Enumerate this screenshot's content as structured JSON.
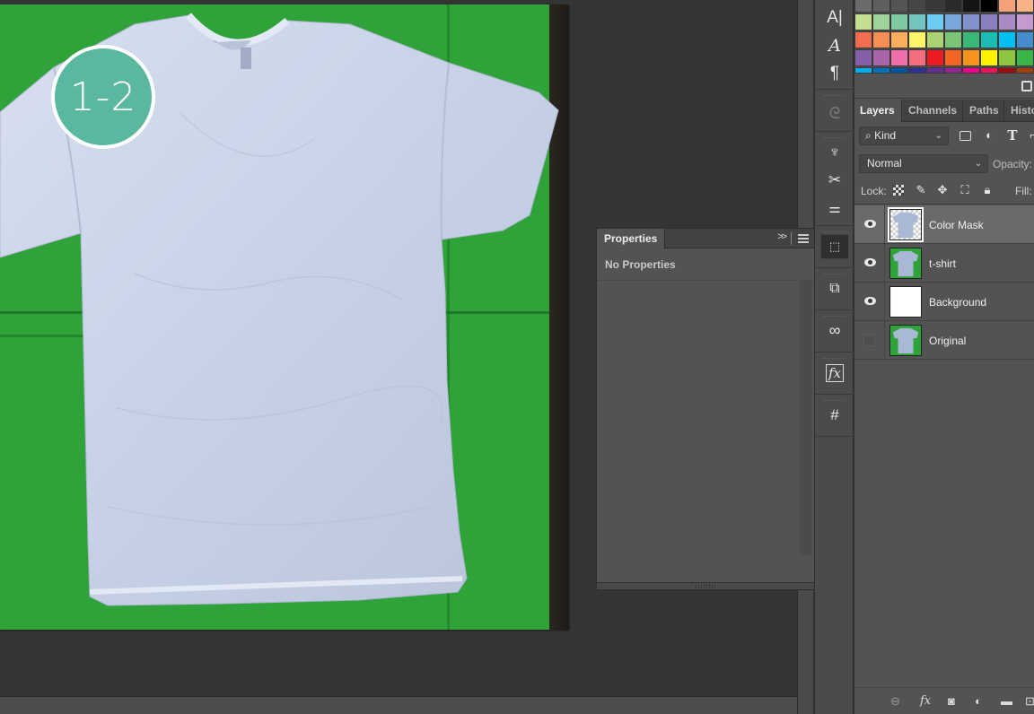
{
  "canvas": {
    "step_badge": "1-2",
    "colors": {
      "green_screen": "#2fa33a",
      "badge": "#5ab8a0"
    }
  },
  "properties_panel": {
    "tab_label": "Properties",
    "collapse_glyph": ">>",
    "empty_text": "No Properties"
  },
  "icon_strip": {
    "groups": [
      [
        "character-icon",
        "character-styles-icon",
        "paragraph-icon"
      ],
      [
        "3d-icon"
      ],
      [
        "brush-presets-icon",
        "tool-presets-icon",
        "brush-settings-icon"
      ],
      [
        "properties-icon"
      ],
      [
        "clone-source-icon"
      ],
      [
        "creative-cloud-libraries-icon"
      ],
      [
        "styles-icon"
      ],
      [
        "patterns-icon"
      ]
    ]
  },
  "swatches": {
    "rows": [
      [
        "#6b6b6b",
        "#5f5f5f",
        "#545454",
        "#464646",
        "#383838",
        "#2a2a2a",
        "#151515",
        "#000000",
        "#f4a07a",
        "#f7b286"
      ],
      [
        "#c4df8f",
        "#9ed39a",
        "#7ec9a2",
        "#73c6bf",
        "#6bcbf2",
        "#79a6dc",
        "#8291cc",
        "#8a7fbf",
        "#a88bc4",
        "#c49bd0"
      ],
      [
        "#f26c4f",
        "#f68e56",
        "#fbaf5d",
        "#fff568",
        "#acd373",
        "#7cc576",
        "#3bb878",
        "#1cbbb4",
        "#00bff3",
        "#448ccb"
      ],
      [
        "#855fa8",
        "#a864a8",
        "#f06eaa",
        "#f26d7d",
        "#ed1c24",
        "#f26522",
        "#f7941d",
        "#fff200",
        "#8dc63f",
        "#39b54a"
      ],
      [
        "#00aeef",
        "#0072bc",
        "#0054a6",
        "#2e3192",
        "#662d91",
        "#92278f",
        "#ec008c",
        "#ed145b",
        "#9e0b0f",
        "#a0410d"
      ]
    ]
  },
  "layers_panel": {
    "tabs": [
      {
        "label": "Layers",
        "active": true
      },
      {
        "label": "Channels",
        "active": false
      },
      {
        "label": "Paths",
        "active": false
      },
      {
        "label": "Histo",
        "active": false
      }
    ],
    "filter": {
      "kind_label": "Kind",
      "search_glyph": "⌕"
    },
    "filter_icons": [
      "image-filter-icon",
      "adjustment-filter-icon",
      "type-filter-icon"
    ],
    "blend_mode": "Normal",
    "opacity_label": "Opacity:",
    "lock_label": "Lock:",
    "lock_icons": [
      "lock-transparent-pixels-icon",
      "lock-image-pixels-icon",
      "lock-position-icon",
      "lock-artboard-icon",
      "lock-all-icon"
    ],
    "fill_label": "Fill:",
    "layers": [
      {
        "name": "Color Mask",
        "visible": true,
        "selected": true,
        "thumb": "masked-shirt"
      },
      {
        "name": "t-shirt",
        "visible": true,
        "selected": false,
        "thumb": "shirt-on-green"
      },
      {
        "name": "Background",
        "visible": true,
        "selected": false,
        "thumb": "white"
      },
      {
        "name": "Original",
        "visible": false,
        "selected": false,
        "thumb": "shirt-on-green"
      }
    ],
    "footer_icons": [
      "link-layers-icon",
      "layer-style-icon",
      "add-mask-icon",
      "adjustment-layer-icon",
      "new-group-icon",
      "new-layer-icon"
    ]
  }
}
